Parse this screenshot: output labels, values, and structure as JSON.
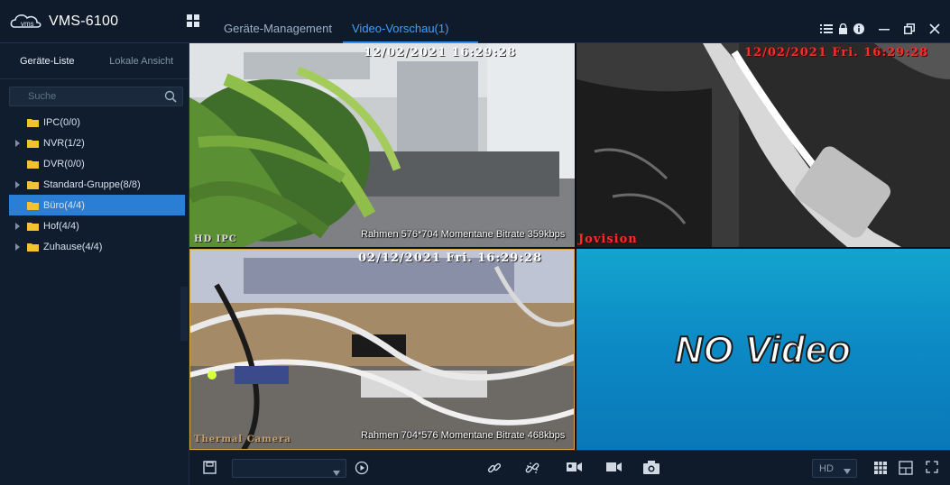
{
  "app": {
    "title": "VMS-6100",
    "logo_text": "vms"
  },
  "nav": {
    "tabs": [
      {
        "label": "Geräte-Management",
        "active": false
      },
      {
        "label": "Video-Vorschau(1)",
        "active": true
      }
    ]
  },
  "sidebar": {
    "tabs": [
      {
        "label": "Geräte-Liste",
        "active": true
      },
      {
        "label": "Lokale Ansicht",
        "active": false
      }
    ],
    "search": {
      "placeholder": "Suche",
      "value": ""
    },
    "tree": [
      {
        "label": "IPC(0/0)",
        "expandable": false,
        "selected": false
      },
      {
        "label": "NVR(1/2)",
        "expandable": true,
        "selected": false
      },
      {
        "label": "DVR(0/0)",
        "expandable": false,
        "selected": false
      },
      {
        "label": "Standard-Gruppe(8/8)",
        "expandable": true,
        "selected": false
      },
      {
        "label": "Büro(4/4)",
        "expandable": true,
        "selected": true
      },
      {
        "label": "Hof(4/4)",
        "expandable": true,
        "selected": false
      },
      {
        "label": "Zuhause(4/4)",
        "expandable": true,
        "selected": false
      }
    ]
  },
  "videos": [
    {
      "timestamp": "12/02/2021 16:29:28",
      "camera_label": "HD IPC",
      "info": "Rahmen 576*704  Momentane Bitrate 359kbps"
    },
    {
      "timestamp": "12/02/2021 Fri. 16:29:28",
      "camera_label": "Jovision",
      "info": ""
    },
    {
      "timestamp": "02/12/2021 Fri. 16:29:28",
      "camera_label": "Thermal Camera",
      "info": "Rahmen 704*576  Momentane Bitrate 468kbps"
    },
    {
      "no_video": "NO Video"
    }
  ],
  "toolbar": {
    "quality": "HD",
    "icons": [
      "save-icon",
      "dropdown",
      "play-circle-icon",
      "link-icon",
      "unlink-icon",
      "record-icon",
      "video-record-icon",
      "snapshot-icon",
      "quality-select",
      "layout-grid-icon",
      "layout-single-icon",
      "fullscreen-icon"
    ]
  },
  "colors": {
    "accent": "#2f8ef0",
    "selected": "#2a7fd4",
    "background": "#0f1b2b",
    "folder": "#f2c230"
  }
}
